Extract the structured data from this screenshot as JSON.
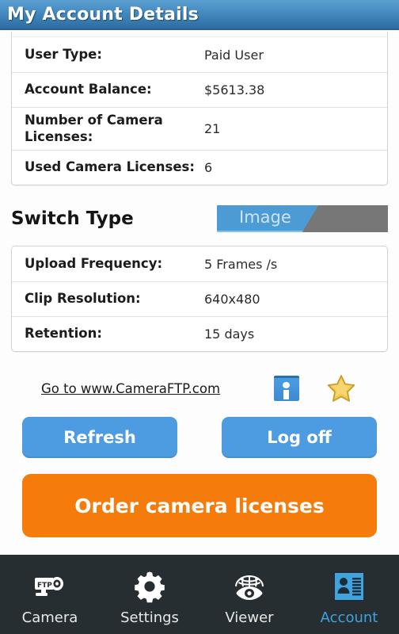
{
  "titlebar": {
    "title": "My Account Details"
  },
  "account_table": {
    "rows": [
      {
        "label": "User Type:",
        "value": "Paid User"
      },
      {
        "label": "Account Balance:",
        "value": "$5613.38"
      },
      {
        "label": "Number of Camera Licenses:",
        "value": "21"
      },
      {
        "label": "Used Camera Licenses:",
        "value": "6"
      }
    ]
  },
  "switch_section": {
    "title": "Switch Type",
    "selected": "Image",
    "blue_color": "#4d9bd4",
    "gray_color": "#777777"
  },
  "settings_table": {
    "rows": [
      {
        "label": "Upload Frequency:",
        "value": "5 Frames /s"
      },
      {
        "label": "Clip Resolution:",
        "value": "640x480"
      },
      {
        "label": "Retention:",
        "value": "15 days"
      }
    ]
  },
  "link_row": {
    "site_link": "Go to www.CameraFTP.com",
    "info_icon": "info-icon",
    "star_icon": "star-icon"
  },
  "buttons": {
    "refresh": "Refresh",
    "logoff": "Log off",
    "order": "Order camera licenses",
    "blue_color": "#4d9be0",
    "orange_color": "#f57c0a"
  },
  "navbar": {
    "background": "#272e31",
    "active_color": "#3fa3df",
    "items": [
      {
        "label": "Camera",
        "icon": "ftp-camera-icon",
        "active": false
      },
      {
        "label": "Settings",
        "icon": "gear-icon",
        "active": false
      },
      {
        "label": "Viewer",
        "icon": "globe-eye-icon",
        "active": false
      },
      {
        "label": "Account",
        "icon": "id-card-icon",
        "active": true
      }
    ]
  }
}
